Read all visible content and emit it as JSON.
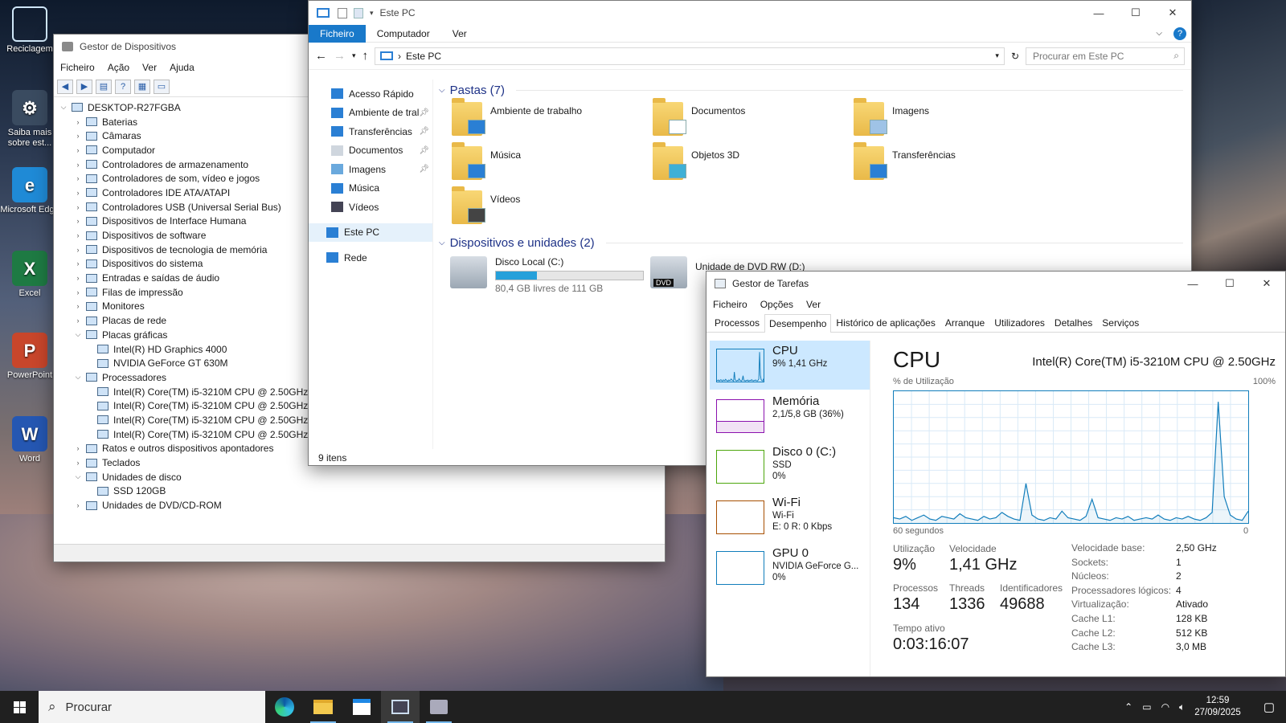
{
  "desktop": {
    "icons": [
      {
        "label": "Reciclagem"
      },
      {
        "label": "Saiba mais sobre est..."
      },
      {
        "label": "Microsoft Edge"
      },
      {
        "label": "Excel"
      },
      {
        "label": "PowerPoint"
      },
      {
        "label": "Word"
      }
    ]
  },
  "devmgr": {
    "title": "Gestor de Dispositivos",
    "menu": [
      "Ficheiro",
      "Ação",
      "Ver",
      "Ajuda"
    ],
    "root": "DESKTOP-R27FGBA",
    "tree": [
      {
        "label": "Baterias",
        "expanded": false,
        "children": []
      },
      {
        "label": "Câmaras",
        "expanded": false,
        "children": []
      },
      {
        "label": "Computador",
        "expanded": false,
        "children": []
      },
      {
        "label": "Controladores de armazenamento",
        "expanded": false,
        "children": []
      },
      {
        "label": "Controladores de som, vídeo e jogos",
        "expanded": false,
        "children": []
      },
      {
        "label": "Controladores IDE ATA/ATAPI",
        "expanded": false,
        "children": []
      },
      {
        "label": "Controladores USB (Universal Serial Bus)",
        "expanded": false,
        "children": []
      },
      {
        "label": "Dispositivos de Interface Humana",
        "expanded": false,
        "children": []
      },
      {
        "label": "Dispositivos de software",
        "expanded": false,
        "children": []
      },
      {
        "label": "Dispositivos de tecnologia de memória",
        "expanded": false,
        "children": []
      },
      {
        "label": "Dispositivos do sistema",
        "expanded": false,
        "children": []
      },
      {
        "label": "Entradas e saídas de áudio",
        "expanded": false,
        "children": []
      },
      {
        "label": "Filas de impressão",
        "expanded": false,
        "children": []
      },
      {
        "label": "Monitores",
        "expanded": false,
        "children": []
      },
      {
        "label": "Placas de rede",
        "expanded": false,
        "children": []
      },
      {
        "label": "Placas gráficas",
        "expanded": true,
        "children": [
          "Intel(R) HD Graphics 4000",
          "NVIDIA GeForce GT 630M"
        ]
      },
      {
        "label": "Processadores",
        "expanded": true,
        "children": [
          "Intel(R) Core(TM) i5-3210M CPU @ 2.50GHz",
          "Intel(R) Core(TM) i5-3210M CPU @ 2.50GHz",
          "Intel(R) Core(TM) i5-3210M CPU @ 2.50GHz",
          "Intel(R) Core(TM) i5-3210M CPU @ 2.50GHz"
        ]
      },
      {
        "label": "Ratos e outros dispositivos apontadores",
        "expanded": false,
        "children": []
      },
      {
        "label": "Teclados",
        "expanded": false,
        "children": []
      },
      {
        "label": "Unidades de disco",
        "expanded": true,
        "children": [
          "SSD 120GB"
        ]
      },
      {
        "label": "Unidades de DVD/CD-ROM",
        "expanded": false,
        "children": []
      }
    ]
  },
  "explorer": {
    "title": "Este PC",
    "ribbon": [
      "Ficheiro",
      "Computador",
      "Ver"
    ],
    "address": "Este PC",
    "search_placeholder": "Procurar em Este PC",
    "nav": [
      {
        "label": "Acesso Rápido",
        "pinned": false
      },
      {
        "label": "Ambiente de tral",
        "pinned": true
      },
      {
        "label": "Transferências",
        "pinned": true
      },
      {
        "label": "Documentos",
        "pinned": true
      },
      {
        "label": "Imagens",
        "pinned": true
      },
      {
        "label": "Música",
        "pinned": false
      },
      {
        "label": "Vídeos",
        "pinned": false
      },
      {
        "label": "Este PC",
        "pinned": false
      },
      {
        "label": "Rede",
        "pinned": false
      }
    ],
    "folders_header": "Pastas (7)",
    "folders": [
      "Ambiente de trabalho",
      "Documentos",
      "Imagens",
      "Música",
      "Objetos 3D",
      "Transferências",
      "Vídeos"
    ],
    "devices_header": "Dispositivos e unidades (2)",
    "drive_c": {
      "name": "Disco Local (C:)",
      "free": "80,4 GB livres de 111 GB",
      "used_fraction": 0.28
    },
    "drive_d": {
      "name": "Unidade de DVD RW (D:)",
      "badge": "DVD"
    },
    "status": "9 itens"
  },
  "taskmgr": {
    "title": "Gestor de Tarefas",
    "menu": [
      "Ficheiro",
      "Opções",
      "Ver"
    ],
    "tabs": [
      "Processos",
      "Desempenho",
      "Histórico de aplicações",
      "Arranque",
      "Utilizadores",
      "Detalhes",
      "Serviços"
    ],
    "resources": [
      {
        "name": "CPU",
        "l1": "9% 1,41 GHz",
        "l2": "",
        "color": "#117dbb"
      },
      {
        "name": "Memória",
        "l1": "2,1/5,8 GB (36%)",
        "l2": "",
        "color": "#8b12ae"
      },
      {
        "name": "Disco 0 (C:)",
        "l1": "SSD",
        "l2": "0%",
        "color": "#4da60c"
      },
      {
        "name": "Wi-Fi",
        "l1": "Wi-Fi",
        "l2": "E: 0 R: 0 Kbps",
        "color": "#a74f01"
      },
      {
        "name": "GPU 0",
        "l1": "NVIDIA GeForce G...",
        "l2": "0%",
        "color": "#117dbb"
      }
    ],
    "perf": {
      "title": "CPU",
      "cpu_name": "Intel(R) Core(TM) i5-3210M CPU @ 2.50GHz",
      "util_label": "% de Utilização",
      "max_label": "100%",
      "time_label": "60 segundos",
      "zero_label": "0",
      "utilizacao_label": "Utilização",
      "utilizacao": "9%",
      "velocidade_label": "Velocidade",
      "velocidade": "1,41 GHz",
      "processos_label": "Processos",
      "processos": "134",
      "threads_label": "Threads",
      "threads": "1336",
      "ident_label": "Identificadores",
      "ident": "49688",
      "tempo_label": "Tempo ativo",
      "tempo": "0:03:16:07",
      "specs": [
        [
          "Velocidade base:",
          "2,50 GHz"
        ],
        [
          "Sockets:",
          "1"
        ],
        [
          "Núcleos:",
          "2"
        ],
        [
          "Processadores lógicos:",
          "4"
        ],
        [
          "Virtualização:",
          "Ativado"
        ],
        [
          "Cache L1:",
          "128 KB"
        ],
        [
          "Cache L2:",
          "512 KB"
        ],
        [
          "Cache L3:",
          "3,0 MB"
        ]
      ]
    },
    "cpu_history": [
      4,
      3,
      5,
      2,
      4,
      6,
      3,
      2,
      5,
      4,
      3,
      7,
      4,
      3,
      2,
      5,
      3,
      4,
      8,
      5,
      3,
      2,
      30,
      6,
      3,
      2,
      4,
      3,
      9,
      4,
      3,
      2,
      5,
      18,
      4,
      3,
      2,
      4,
      3,
      5,
      2,
      3,
      4,
      3,
      6,
      3,
      2,
      4,
      3,
      5,
      3,
      2,
      4,
      8,
      92,
      20,
      6,
      3,
      2,
      9
    ]
  },
  "taskbar": {
    "search": "Procurar",
    "time": "12:59",
    "date": "27/09/2025"
  }
}
